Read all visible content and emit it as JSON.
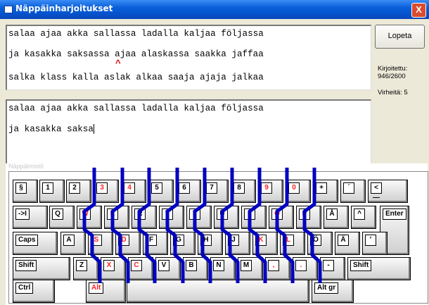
{
  "window": {
    "title": "Näppäinharjoitukset",
    "close_label": "X"
  },
  "target_text": {
    "lines": [
      "salaa ajaa akka sallassa ladalla kaljaa följassa",
      "ja kasakka saksassa ajaa alaskassa saakka jaffaa",
      "salka klass kalla aslak alkaa saaja ajaja jalkaa"
    ],
    "position_marker": "^"
  },
  "typed_text": {
    "lines": [
      "salaa ajaa akka sallassa ladalla kaljaa följassa",
      "ja kasakka saksa"
    ]
  },
  "sidebar": {
    "quit_label": "Lopeta",
    "written_label": "Kirjoitettu:",
    "written_value": "946/2600",
    "errors_text": "Virheitä: 5"
  },
  "keyboard": {
    "title": "Näppäimistö",
    "accent_color": "#ff2020",
    "finger_line_color": "#0000c0",
    "row0": [
      {
        "k": "§",
        "c": "#000000"
      },
      {
        "k": "1",
        "c": "#000000"
      },
      {
        "k": "2",
        "c": "#000000"
      },
      {
        "k": "3",
        "c": "#ff2020"
      },
      {
        "k": "4",
        "c": "#ff2020"
      },
      {
        "k": "5",
        "c": "#000000"
      },
      {
        "k": "6",
        "c": "#000000"
      },
      {
        "k": "7",
        "c": "#000000"
      },
      {
        "k": "8",
        "c": "#000000"
      },
      {
        "k": "9",
        "c": "#ff2020"
      },
      {
        "k": "0",
        "c": "#ff2020"
      },
      {
        "k": "+",
        "c": "#000000"
      },
      {
        "k": "´",
        "c": "#000000"
      },
      {
        "k": "<—",
        "c": "#000000"
      }
    ],
    "row1": [
      {
        "k": "->I",
        "c": "#000000"
      },
      {
        "k": "Q",
        "c": "#000000"
      },
      {
        "k": "W",
        "c": "#ff2020"
      },
      {
        "k": "E",
        "c": "#ff2020"
      },
      {
        "k": "R",
        "c": "#000000"
      },
      {
        "k": "T",
        "c": "#000000"
      },
      {
        "k": "Y",
        "c": "#000000"
      },
      {
        "k": "U",
        "c": "#000000"
      },
      {
        "k": "I",
        "c": "#ff2020"
      },
      {
        "k": "O",
        "c": "#ff2020"
      },
      {
        "k": "P",
        "c": "#000000"
      },
      {
        "k": "Å",
        "c": "#000000"
      },
      {
        "k": "^",
        "c": "#000000"
      },
      {
        "k": "Enter",
        "c": "#000000"
      }
    ],
    "row2": [
      {
        "k": "Caps",
        "c": "#000000"
      },
      {
        "k": "A",
        "c": "#000000"
      },
      {
        "k": "S",
        "c": "#ff2020"
      },
      {
        "k": "D",
        "c": "#ff2020"
      },
      {
        "k": "F",
        "c": "#000000"
      },
      {
        "k": "G",
        "c": "#000000"
      },
      {
        "k": "H",
        "c": "#000000"
      },
      {
        "k": "J",
        "c": "#000000"
      },
      {
        "k": "K",
        "c": "#ff2020"
      },
      {
        "k": "L",
        "c": "#ff2020"
      },
      {
        "k": "Ö",
        "c": "#000000"
      },
      {
        "k": "Ä",
        "c": "#000000"
      },
      {
        "k": "'",
        "c": "#000000"
      }
    ],
    "row3": [
      {
        "k": "Shift",
        "c": "#000000"
      },
      {
        "k": "Z",
        "c": "#000000"
      },
      {
        "k": "X",
        "c": "#ff2020"
      },
      {
        "k": "C",
        "c": "#ff2020"
      },
      {
        "k": "V",
        "c": "#000000"
      },
      {
        "k": "B",
        "c": "#000000"
      },
      {
        "k": "N",
        "c": "#000000"
      },
      {
        "k": "M",
        "c": "#000000"
      },
      {
        "k": ",",
        "c": "#ff2020"
      },
      {
        "k": ".",
        "c": "#ff2020"
      },
      {
        "k": "-",
        "c": "#000000"
      },
      {
        "k": "Shift",
        "c": "#000000"
      }
    ],
    "row4": [
      {
        "k": "Ctrl",
        "c": "#000000"
      },
      {
        "k": "Alt",
        "c": "#ff2020"
      },
      {
        "k": "",
        "c": "#000000"
      },
      {
        "k": "Alt gr",
        "c": "#000000"
      }
    ]
  }
}
